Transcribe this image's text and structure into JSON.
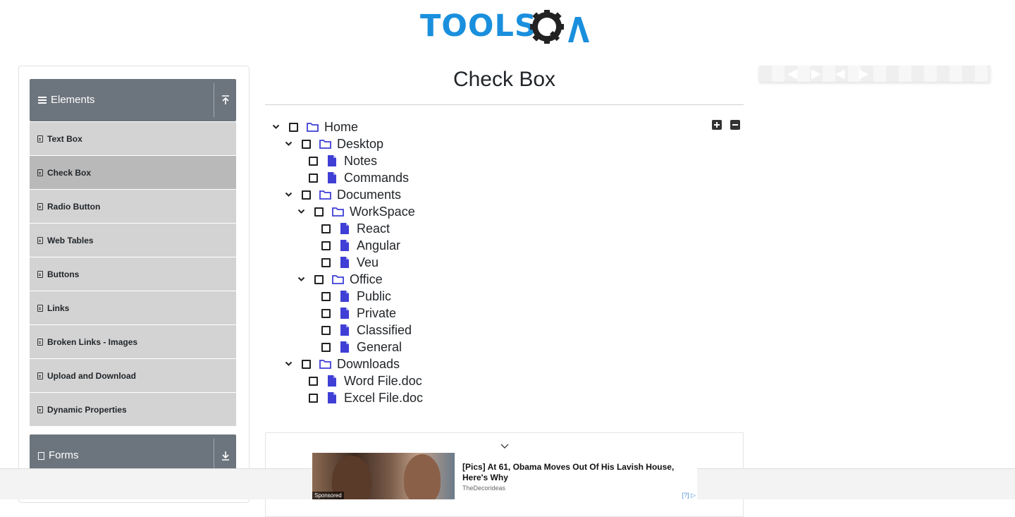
{
  "header": {
    "logo_text": "TOOLS",
    "logo_alt": "TOOLSQA"
  },
  "sidebar": {
    "elements_group": {
      "label": "Elements",
      "toggle_icon": "arrow-up-icon"
    },
    "items": [
      {
        "label": "Text Box",
        "active": false
      },
      {
        "label": "Check Box",
        "active": true
      },
      {
        "label": "Radio Button",
        "active": false
      },
      {
        "label": "Web Tables",
        "active": false
      },
      {
        "label": "Buttons",
        "active": false
      },
      {
        "label": "Links",
        "active": false
      },
      {
        "label": "Broken Links - Images",
        "active": false
      },
      {
        "label": "Upload and Download",
        "active": false
      },
      {
        "label": "Dynamic Properties",
        "active": false
      }
    ],
    "forms_group": {
      "label": "Forms",
      "toggle_icon": "arrow-down-icon"
    }
  },
  "main": {
    "title": "Check Box",
    "tree": [
      {
        "label": "Home",
        "type": "folder",
        "level": 0,
        "expanded": true,
        "checked": false
      },
      {
        "label": "Desktop",
        "type": "folder",
        "level": 1,
        "expanded": true,
        "checked": false
      },
      {
        "label": "Notes",
        "type": "file",
        "level": 2,
        "checked": false
      },
      {
        "label": "Commands",
        "type": "file",
        "level": 2,
        "checked": false
      },
      {
        "label": "Documents",
        "type": "folder",
        "level": 1,
        "expanded": true,
        "checked": false
      },
      {
        "label": "WorkSpace",
        "type": "folder",
        "level": 2,
        "expanded": true,
        "checked": false
      },
      {
        "label": "React",
        "type": "file",
        "level": 3,
        "checked": false
      },
      {
        "label": "Angular",
        "type": "file",
        "level": 3,
        "checked": false
      },
      {
        "label": "Veu",
        "type": "file",
        "level": 3,
        "checked": false
      },
      {
        "label": "Office",
        "type": "folder",
        "level": 2,
        "expanded": true,
        "checked": false
      },
      {
        "label": "Public",
        "type": "file",
        "level": 3,
        "checked": false
      },
      {
        "label": "Private",
        "type": "file",
        "level": 3,
        "checked": false
      },
      {
        "label": "Classified",
        "type": "file",
        "level": 3,
        "checked": false
      },
      {
        "label": "General",
        "type": "file",
        "level": 3,
        "checked": false
      },
      {
        "label": "Downloads",
        "type": "folder",
        "level": 1,
        "expanded": true,
        "checked": false
      },
      {
        "label": "Word File.doc",
        "type": "file",
        "level": 2,
        "checked": false
      },
      {
        "label": "Excel File.doc",
        "type": "file",
        "level": 2,
        "checked": false
      }
    ],
    "expand_all_icon": "plus-square-icon",
    "collapse_all_icon": "minus-square-icon"
  },
  "ad": {
    "headline": "[Pics] At 61, Obama Moves Out Of His Lavish House, Here's Why",
    "source": "TheDecorideas",
    "sponsored": "Sponsored",
    "choice": "[?]"
  },
  "colors": {
    "accent": "#1a8fdd",
    "sidebar_header": "#6c757d",
    "menu_item": "#d3d3d3",
    "menu_item_active": "#b9b9b9",
    "tree_icon": "#3f3fd6"
  }
}
